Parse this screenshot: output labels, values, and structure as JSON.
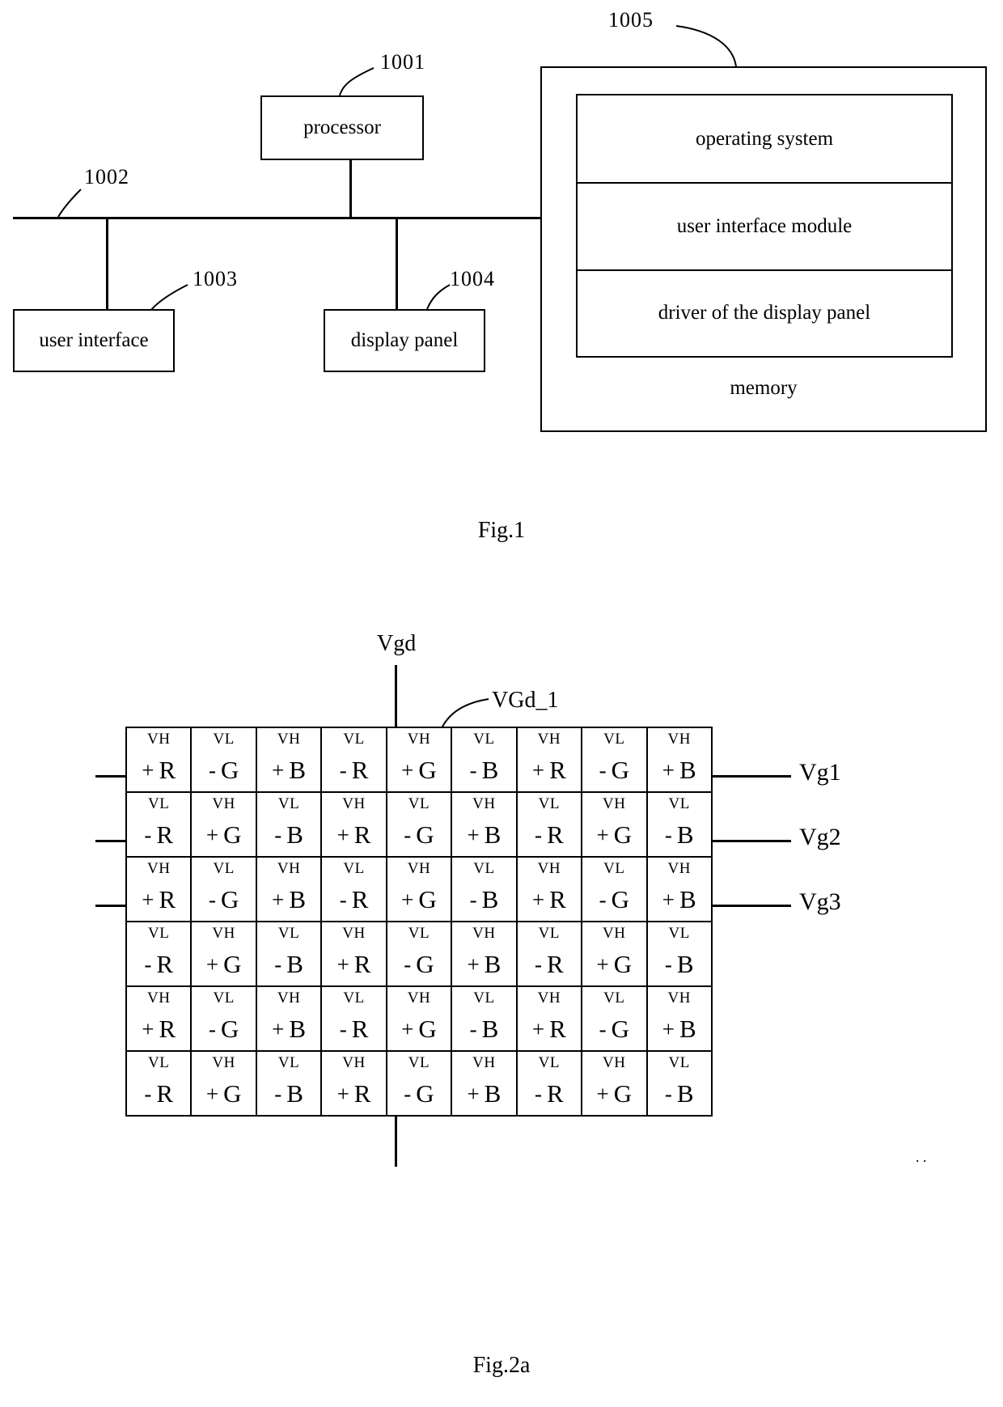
{
  "fig1": {
    "caption": "Fig.1",
    "processor": {
      "label": "processor",
      "ref": "1001"
    },
    "bus": {
      "ref": "1002"
    },
    "user_interface": {
      "label": "user interface",
      "ref": "1003"
    },
    "display_panel": {
      "label": "display panel",
      "ref": "1004"
    },
    "memory": {
      "label": "memory",
      "ref": "1005",
      "modules": [
        "operating system",
        "user interface module",
        "driver of the display panel"
      ]
    }
  },
  "fig2a": {
    "caption": "Fig.2a",
    "vgd_label": "Vgd",
    "vgd1_label": "VGd_1",
    "gate_labels": [
      "Vg1",
      "Vg2",
      "Vg3"
    ],
    "corner_marks": ". .",
    "grid": {
      "columns": 9,
      "rows": 6,
      "cells": [
        [
          {
            "v": "VH",
            "sign": "+",
            "ch": "R"
          },
          {
            "v": "VL",
            "sign": "-",
            "ch": "G"
          },
          {
            "v": "VH",
            "sign": "+",
            "ch": "B"
          },
          {
            "v": "VL",
            "sign": "-",
            "ch": "R"
          },
          {
            "v": "VH",
            "sign": "+",
            "ch": "G"
          },
          {
            "v": "VL",
            "sign": "-",
            "ch": "B"
          },
          {
            "v": "VH",
            "sign": "+",
            "ch": "R"
          },
          {
            "v": "VL",
            "sign": "-",
            "ch": "G"
          },
          {
            "v": "VH",
            "sign": "+",
            "ch": "B"
          }
        ],
        [
          {
            "v": "VL",
            "sign": "-",
            "ch": "R"
          },
          {
            "v": "VH",
            "sign": "+",
            "ch": "G"
          },
          {
            "v": "VL",
            "sign": "-",
            "ch": "B"
          },
          {
            "v": "VH",
            "sign": "+",
            "ch": "R"
          },
          {
            "v": "VL",
            "sign": "-",
            "ch": "G"
          },
          {
            "v": "VH",
            "sign": "+",
            "ch": "B"
          },
          {
            "v": "VL",
            "sign": "-",
            "ch": "R"
          },
          {
            "v": "VH",
            "sign": "+",
            "ch": "G"
          },
          {
            "v": "VL",
            "sign": "-",
            "ch": "B"
          }
        ],
        [
          {
            "v": "VH",
            "sign": "+",
            "ch": "R"
          },
          {
            "v": "VL",
            "sign": "-",
            "ch": "G"
          },
          {
            "v": "VH",
            "sign": "+",
            "ch": "B"
          },
          {
            "v": "VL",
            "sign": "-",
            "ch": "R"
          },
          {
            "v": "VH",
            "sign": "+",
            "ch": "G"
          },
          {
            "v": "VL",
            "sign": "-",
            "ch": "B"
          },
          {
            "v": "VH",
            "sign": "+",
            "ch": "R"
          },
          {
            "v": "VL",
            "sign": "-",
            "ch": "G"
          },
          {
            "v": "VH",
            "sign": "+",
            "ch": "B"
          }
        ],
        [
          {
            "v": "VL",
            "sign": "-",
            "ch": "R"
          },
          {
            "v": "VH",
            "sign": "+",
            "ch": "G"
          },
          {
            "v": "VL",
            "sign": "-",
            "ch": "B"
          },
          {
            "v": "VH",
            "sign": "+",
            "ch": "R"
          },
          {
            "v": "VL",
            "sign": "-",
            "ch": "G"
          },
          {
            "v": "VH",
            "sign": "+",
            "ch": "B"
          },
          {
            "v": "VL",
            "sign": "-",
            "ch": "R"
          },
          {
            "v": "VH",
            "sign": "+",
            "ch": "G"
          },
          {
            "v": "VL",
            "sign": "-",
            "ch": "B"
          }
        ],
        [
          {
            "v": "VH",
            "sign": "+",
            "ch": "R"
          },
          {
            "v": "VL",
            "sign": "-",
            "ch": "G"
          },
          {
            "v": "VH",
            "sign": "+",
            "ch": "B"
          },
          {
            "v": "VL",
            "sign": "-",
            "ch": "R"
          },
          {
            "v": "VH",
            "sign": "+",
            "ch": "G"
          },
          {
            "v": "VL",
            "sign": "-",
            "ch": "B"
          },
          {
            "v": "VH",
            "sign": "+",
            "ch": "R"
          },
          {
            "v": "VL",
            "sign": "-",
            "ch": "G"
          },
          {
            "v": "VH",
            "sign": "+",
            "ch": "B"
          }
        ],
        [
          {
            "v": "VL",
            "sign": "-",
            "ch": "R"
          },
          {
            "v": "VH",
            "sign": "+",
            "ch": "G"
          },
          {
            "v": "VL",
            "sign": "-",
            "ch": "B"
          },
          {
            "v": "VH",
            "sign": "+",
            "ch": "R"
          },
          {
            "v": "VL",
            "sign": "-",
            "ch": "G"
          },
          {
            "v": "VH",
            "sign": "+",
            "ch": "B"
          },
          {
            "v": "VL",
            "sign": "-",
            "ch": "R"
          },
          {
            "v": "VH",
            "sign": "+",
            "ch": "G"
          },
          {
            "v": "VL",
            "sign": "-",
            "ch": "B"
          }
        ]
      ]
    }
  }
}
